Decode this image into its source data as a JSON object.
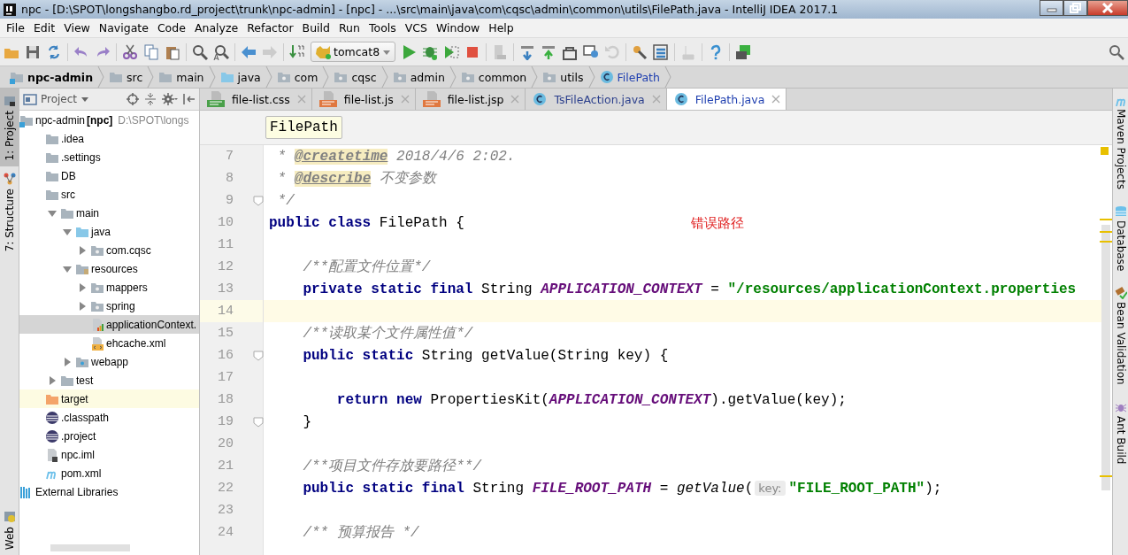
{
  "window": {
    "title": "npc - [D:\\SPOT\\longshangbo.rd_project\\trunk\\npc-admin] - [npc] - ...\\src\\main\\java\\com\\cqsc\\admin\\common\\utils\\FilePath.java - IntelliJ IDEA 2017.1"
  },
  "menu": [
    "File",
    "Edit",
    "View",
    "Navigate",
    "Code",
    "Analyze",
    "Refactor",
    "Build",
    "Run",
    "Tools",
    "VCS",
    "Window",
    "Help"
  ],
  "toolbar": {
    "run_config": "tomcat8"
  },
  "breadcrumbs": [
    {
      "label": "npc-admin",
      "kind": "module"
    },
    {
      "label": "src",
      "kind": "folder"
    },
    {
      "label": "main",
      "kind": "folder"
    },
    {
      "label": "java",
      "kind": "source"
    },
    {
      "label": "com",
      "kind": "package"
    },
    {
      "label": "cqsc",
      "kind": "package"
    },
    {
      "label": "admin",
      "kind": "package"
    },
    {
      "label": "common",
      "kind": "package"
    },
    {
      "label": "utils",
      "kind": "package"
    },
    {
      "label": "FilePath",
      "kind": "class"
    }
  ],
  "left_stripe": [
    {
      "label": "1: Project",
      "selected": true
    },
    {
      "label": "7: Structure",
      "selected": false
    },
    {
      "label": "Web",
      "selected": false
    }
  ],
  "project_panel": {
    "title": "Project",
    "tree": [
      {
        "label": "npc-admin",
        "bold_suffix": "[npc]",
        "path": "D:\\SPOT\\longs",
        "kind": "module",
        "selected": false,
        "children": [
          {
            "label": ".idea",
            "kind": "folder",
            "selected": false
          },
          {
            "label": ".settings",
            "kind": "folder",
            "selected": false
          },
          {
            "label": "DB",
            "kind": "folder",
            "selected": false
          },
          {
            "label": "src",
            "kind": "folder",
            "selected": false,
            "children": [
              {
                "label": "main",
                "kind": "folder",
                "expanded": true,
                "selected": false,
                "children": [
                  {
                    "label": "java",
                    "kind": "source",
                    "expanded": true,
                    "selected": false,
                    "children": [
                      {
                        "label": "com.cqsc",
                        "kind": "package",
                        "expanded": false,
                        "selected": false
                      }
                    ]
                  },
                  {
                    "label": "resources",
                    "kind": "resources",
                    "expanded": true,
                    "selected": false,
                    "children": [
                      {
                        "label": "mappers",
                        "kind": "package",
                        "expanded": false,
                        "selected": false
                      },
                      {
                        "label": "spring",
                        "kind": "package",
                        "expanded": false,
                        "selected": false
                      },
                      {
                        "label": "applicationContext.",
                        "kind": "properties",
                        "selected": true
                      },
                      {
                        "label": "ehcache.xml",
                        "kind": "xml",
                        "selected": false
                      }
                    ]
                  },
                  {
                    "label": "webapp",
                    "kind": "web",
                    "expanded": false,
                    "selected": false
                  }
                ]
              },
              {
                "label": "test",
                "kind": "folder",
                "expanded": false,
                "selected": false
              }
            ]
          },
          {
            "label": "target",
            "kind": "excluded",
            "selected": false
          },
          {
            "label": ".classpath",
            "kind": "eclipse",
            "selected": false
          },
          {
            "label": ".project",
            "kind": "eclipse",
            "selected": false
          },
          {
            "label": "npc.iml",
            "kind": "iml",
            "selected": false
          },
          {
            "label": "pom.xml",
            "kind": "maven",
            "selected": false
          }
        ]
      },
      {
        "label": "External Libraries",
        "kind": "libraries",
        "selected": false
      }
    ]
  },
  "tabs": [
    {
      "label": "file-list.css",
      "kind": "css",
      "selected": false
    },
    {
      "label": "file-list.js",
      "kind": "js",
      "selected": false
    },
    {
      "label": "file-list.jsp",
      "kind": "jsp",
      "selected": false
    },
    {
      "label": "TsFileAction.java",
      "kind": "java",
      "selected": false
    },
    {
      "label": "FilePath.java",
      "kind": "java",
      "selected": true
    }
  ],
  "editor": {
    "breadcrumb_tip": "FilePath",
    "annotation": "错误路径",
    "lines": [
      {
        "number": "7",
        "current": false,
        "fold": false,
        "segments": [
          {
            "kind": "comment",
            "text": " * "
          },
          {
            "kind": "doctag",
            "text": "@createtime"
          },
          {
            "kind": "comment",
            "text": " 2018/4/6 2:02."
          }
        ]
      },
      {
        "number": "8",
        "current": false,
        "fold": false,
        "segments": [
          {
            "kind": "comment",
            "text": " * "
          },
          {
            "kind": "doctag",
            "text": "@describe"
          },
          {
            "kind": "comment",
            "text": " 不变参数"
          }
        ]
      },
      {
        "number": "9",
        "current": false,
        "fold": true,
        "segments": [
          {
            "kind": "comment",
            "text": " */"
          }
        ]
      },
      {
        "number": "10",
        "current": false,
        "fold": false,
        "segments": [
          {
            "kind": "keyword",
            "text": "public class "
          },
          {
            "kind": "plain",
            "text": "FilePath {"
          }
        ]
      },
      {
        "number": "11",
        "current": false,
        "fold": false
      },
      {
        "number": "12",
        "current": false,
        "fold": false,
        "segments": [
          {
            "kind": "comment",
            "text": "    /**配置文件位置*/"
          }
        ]
      },
      {
        "number": "13",
        "current": false,
        "fold": false,
        "segments": [
          {
            "kind": "keyword",
            "text": "    private static final "
          },
          {
            "kind": "plain",
            "text": "String "
          },
          {
            "kind": "field",
            "text": "APPLICATION_CONTEXT"
          },
          {
            "kind": "plain",
            "text": " = "
          },
          {
            "kind": "string",
            "text": "\"/resources/applicationContext.properties"
          }
        ]
      },
      {
        "number": "14",
        "current": true,
        "fold": false
      },
      {
        "number": "15",
        "current": false,
        "fold": false,
        "segments": [
          {
            "kind": "comment",
            "text": "    /**读取某个文件属性值*/"
          }
        ]
      },
      {
        "number": "16",
        "current": false,
        "fold": true,
        "segments": [
          {
            "kind": "keyword",
            "text": "    public static "
          },
          {
            "kind": "plain",
            "text": "String getValue(String key) {"
          }
        ]
      },
      {
        "number": "17",
        "current": false,
        "fold": false
      },
      {
        "number": "18",
        "current": false,
        "fold": false,
        "segments": [
          {
            "kind": "keyword",
            "text": "        return new "
          },
          {
            "kind": "plain",
            "text": "PropertiesKit("
          },
          {
            "kind": "field",
            "text": "APPLICATION_CONTEXT"
          },
          {
            "kind": "plain",
            "text": ").getValue(key);"
          }
        ]
      },
      {
        "number": "19",
        "current": false,
        "fold": true,
        "segments": [
          {
            "kind": "plain",
            "text": "    }"
          }
        ]
      },
      {
        "number": "20",
        "current": false,
        "fold": false
      },
      {
        "number": "21",
        "current": false,
        "fold": false,
        "segments": [
          {
            "kind": "comment",
            "text": "    /**项目文件存放要路径**/"
          }
        ]
      },
      {
        "number": "22",
        "current": false,
        "fold": false,
        "segments": [
          {
            "kind": "keyword",
            "text": "    public static final "
          },
          {
            "kind": "plain",
            "text": "String "
          },
          {
            "kind": "field",
            "text": "FILE_ROOT_PATH"
          },
          {
            "kind": "plain",
            "text": " = "
          },
          {
            "kind": "method",
            "text": "getValue"
          },
          {
            "kind": "plain",
            "text": "("
          },
          {
            "kind": "hint",
            "text": "key:"
          },
          {
            "kind": "string",
            "text": "\"FILE_ROOT_PATH\""
          },
          {
            "kind": "plain",
            "text": ");"
          }
        ]
      },
      {
        "number": "23",
        "current": false,
        "fold": false
      },
      {
        "number": "24",
        "current": false,
        "fold": false,
        "segments": [
          {
            "kind": "comment",
            "text": "    /** 预算报告 */"
          }
        ]
      }
    ]
  },
  "right_stripe": [
    {
      "label": "Maven Projects",
      "kind": "maven"
    },
    {
      "label": "Database",
      "kind": "database"
    },
    {
      "label": "Bean Validation",
      "kind": "bean"
    },
    {
      "label": "Ant Build",
      "kind": "ant"
    }
  ]
}
